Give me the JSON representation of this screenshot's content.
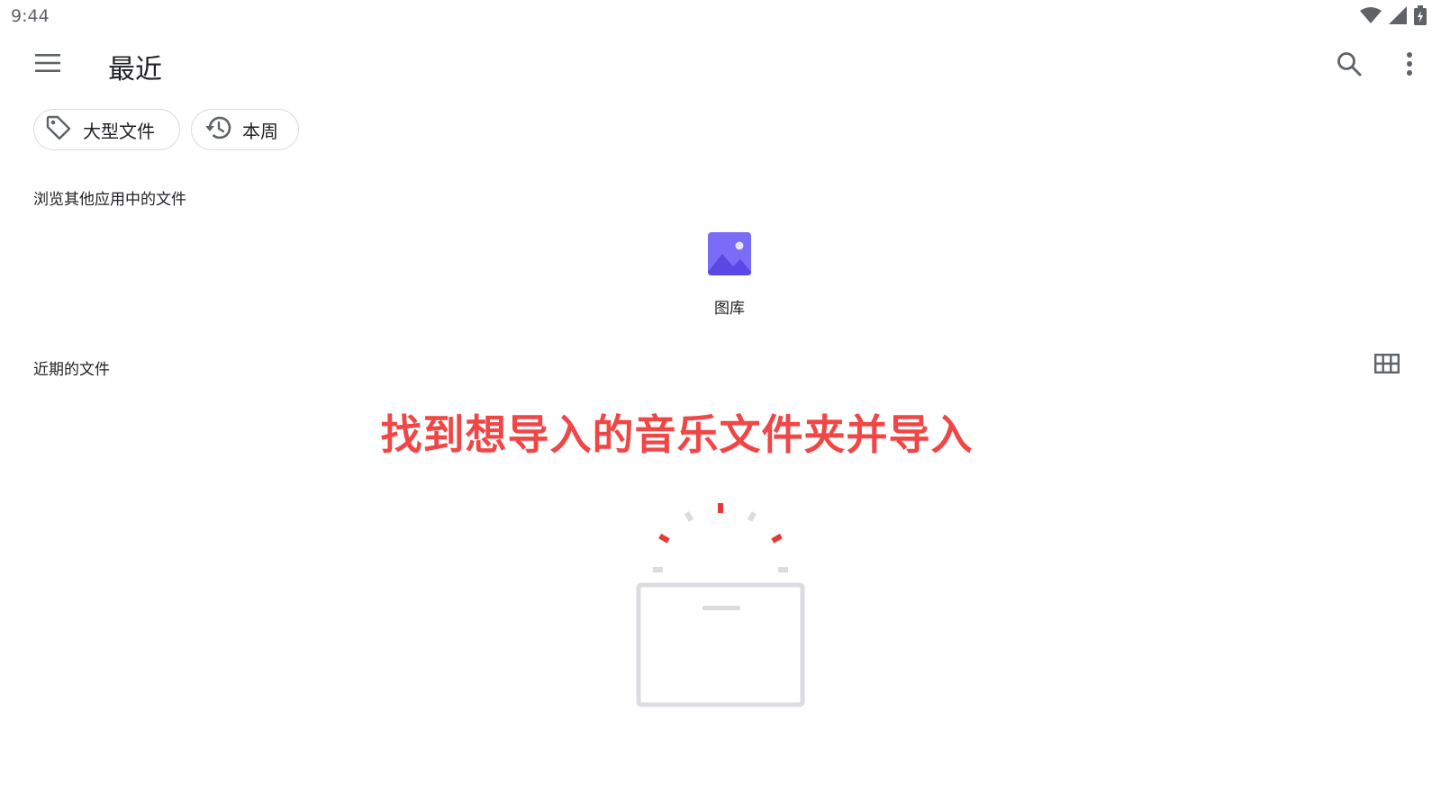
{
  "status_bar": {
    "time": "9:44"
  },
  "toolbar": {
    "title": "最近",
    "menu_icon": "hamburger-menu-icon",
    "search_icon": "search-icon",
    "more_icon": "more-vert-icon"
  },
  "chips": [
    {
      "label": "大型文件",
      "icon": "tag-icon"
    },
    {
      "label": "本周",
      "icon": "history-icon"
    }
  ],
  "browse_section": {
    "label": "浏览其他应用中的文件",
    "roots": [
      {
        "label": "图库",
        "icon": "gallery-photo-icon",
        "color": "#7b6cf6"
      }
    ]
  },
  "recent_section": {
    "label": "近期的文件",
    "view_toggle_icon": "grid-view-icon"
  },
  "annotation": {
    "text": "找到想导入的音乐文件夹并导入",
    "color": "#f04646"
  },
  "empty_state": {
    "icon": "empty-box-icon",
    "accent": "#e53935"
  }
}
